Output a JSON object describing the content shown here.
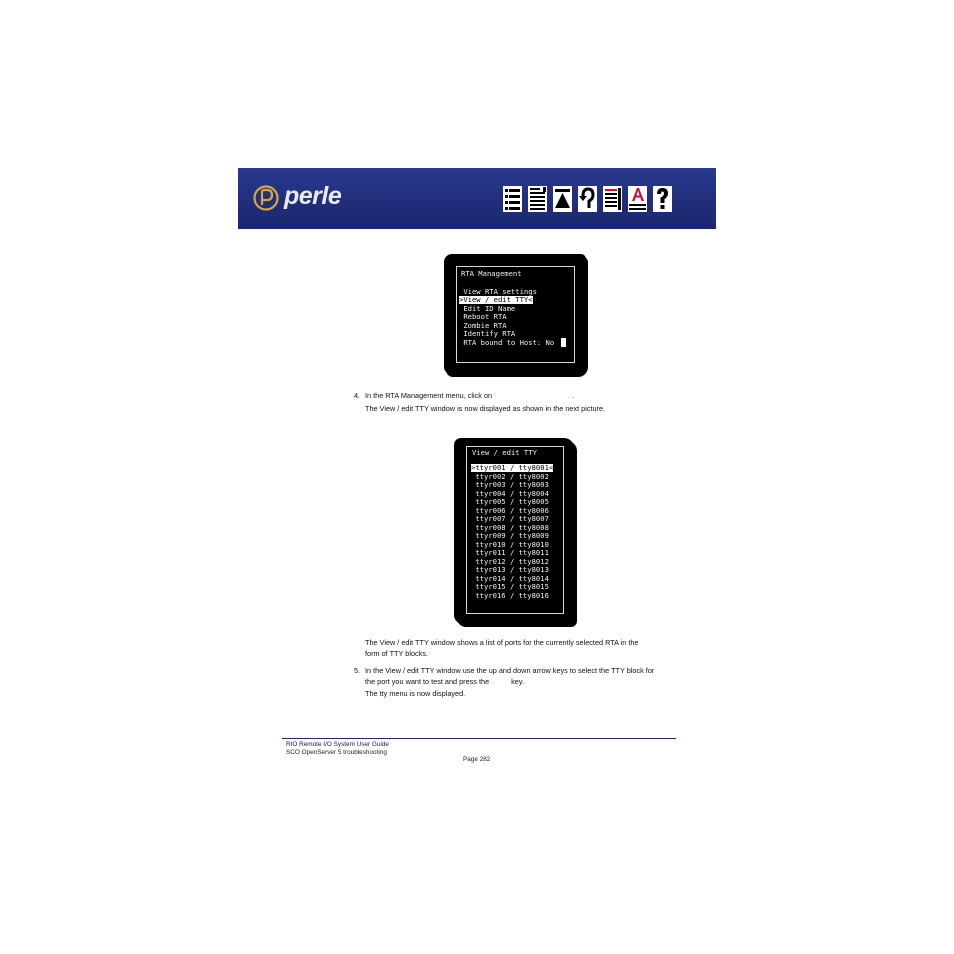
{
  "header": {
    "brand": "perle",
    "nav_icons": [
      "contents-icon",
      "index-icon",
      "top-icon",
      "back-icon",
      "pdf-document-icon",
      "text-annotation-icon",
      "help-icon"
    ],
    "colors": {
      "banner": "#22318a",
      "brand_text": "#e8eaf2",
      "icon_face": "#ffffff",
      "icon_red": "#c8102e"
    }
  },
  "screen1": {
    "title": "RTA Management",
    "items": [
      " View RTA settings",
      ">View / edit TTY<",
      " Edit ID Name",
      " Reboot RTA",
      " Zombie RTA",
      " Identify RTA",
      " RTA bound to Host: No"
    ],
    "selected_index": 1
  },
  "step4": {
    "number": "4.",
    "text": "In the RTA Management menu, click on",
    "text_end": ".",
    "note": "The View / edit TTY window is now displayed as shown in the next picture."
  },
  "screen2": {
    "title": "View / edit TTY",
    "rows": [
      ">ttyr001 / tty8001<",
      " ttyr002 / tty8002",
      " ttyr003 / tty8003",
      " ttyr004 / tty8004",
      " ttyr005 / tty8005",
      " ttyr006 / tty8006",
      " ttyr007 / tty8007",
      " ttyr008 / tty8008",
      " ttyr009 / tty8009",
      " ttyr010 / tty8010",
      " ttyr011 / tty8011",
      " ttyr012 / tty8012",
      " ttyr013 / tty8013",
      " ttyr014 / tty8014",
      " ttyr015 / tty8015",
      " ttyr016 / tty8016"
    ],
    "selected_index": 0
  },
  "para": {
    "line1": "The View / edit TTY window shows a list of ports for the currently selected RTA in the",
    "line2": "form of TTY blocks."
  },
  "step5": {
    "number": "5.",
    "line1": "In the View / edit TTY window use the up and down arrow keys to select the TTY block for",
    "line2": "the port you want to test and press the",
    "line2_end": "key.",
    "note": "The tty menu is now displayed."
  },
  "footer": {
    "line1": "RIO Remote I/O System User Guide",
    "line2": "SCO OpenServer 5 troubleshooting",
    "page": "Page 282"
  }
}
